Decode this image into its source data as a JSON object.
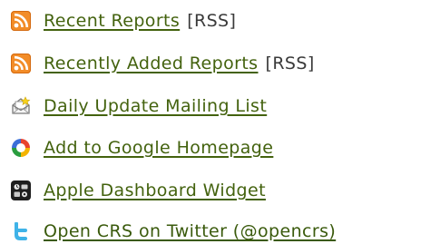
{
  "links": [
    {
      "label": "Recent Reports",
      "suffix": "[RSS]",
      "icon": "rss-icon",
      "color": "#43620e"
    },
    {
      "label": "Recently Added Reports",
      "suffix": "[RSS]",
      "icon": "rss-icon",
      "color": "#43620e"
    },
    {
      "label": "Daily Update Mailing List",
      "icon": "mail-icon",
      "color": "#43620e"
    },
    {
      "label": "Add to Google Homepage",
      "icon": "google-icon",
      "color": "#43620e"
    },
    {
      "label": "Apple Dashboard Widget",
      "icon": "dashboard-icon",
      "color": "#43620e"
    },
    {
      "label": "Open CRS on Twitter (@opencrs)",
      "icon": "twitter-icon",
      "color": "#43620e"
    }
  ],
  "colors": {
    "link": "#43620e",
    "rss_orange": "#f28c28",
    "twitter_blue": "#3fb3e8"
  }
}
